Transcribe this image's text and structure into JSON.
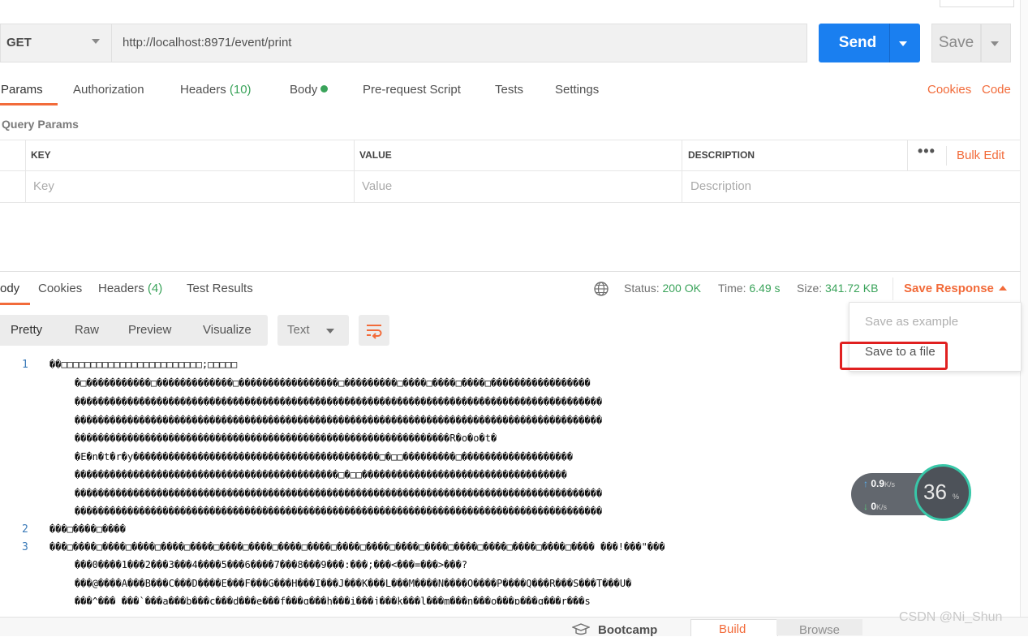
{
  "request": {
    "method": "GET",
    "url": "http://localhost:8971/event/print",
    "send_label": "Send",
    "save_label": "Save"
  },
  "request_tabs": {
    "params": "Params",
    "authorization": "Authorization",
    "headers": "Headers",
    "headers_count": "(10)",
    "body": "Body",
    "prerequest": "Pre-request Script",
    "tests": "Tests",
    "settings": "Settings",
    "cookies": "Cookies",
    "code": "Code"
  },
  "query_params": {
    "title": "Query Params",
    "columns": {
      "key": "KEY",
      "value": "VALUE",
      "description": "DESCRIPTION"
    },
    "placeholders": {
      "key": "Key",
      "value": "Value",
      "description": "Description"
    },
    "more": "•••",
    "bulk_edit": "Bulk Edit"
  },
  "response_tabs": {
    "body": "ody",
    "cookies": "Cookies",
    "headers": "Headers",
    "headers_count": "(4)",
    "test_results": "Test Results"
  },
  "response_meta": {
    "status_label": "Status:",
    "status_value": "200 OK",
    "time_label": "Time:",
    "time_value": "6.49 s",
    "size_label": "Size:",
    "size_value": "341.72 KB",
    "save_response": "Save Response"
  },
  "view_toolbar": {
    "pretty": "Pretty",
    "raw": "Raw",
    "preview": "Preview",
    "visualize": "Visualize",
    "format": "Text"
  },
  "dropdown": {
    "save_as_example": "Save as example",
    "save_to_file": "Save to a file"
  },
  "code": {
    "line_numbers": [
      "1",
      "2",
      "3"
    ],
    "lines": [
      "��□□□□□□□□□□□□□□□□□□□□□□□□;□□□□□",
      "�□�����������□�������������□�����������������□���������□����□����□����□�����������������",
      "������������������������������������������������������������������������������������������",
      "������������������������������������������������������������������������������������������",
      "����������������������������������������������������������������R�o�o�t�",
      "�E�n�t�r�y������������������������������������������□�□□���������□�������������������",
      "���������������������������������������������□�□□�����������������������������������",
      "������������������������������������������������������������������������������������������",
      "������������������������������������������������������������������������������������������",
      "���□����□����",
      "���□����□����□����□����□����□����□����□����□����□����□����□����□����□����□����□����□����□���� ���!���\"���",
      "���0����1���2���3���4����5���6����7���8���9���:���;���<���=���>���?",
      "���@����A���B���C���D����E���F���G���H���I���J���K���L���M����N����O����P����Q���R���S���T���U�",
      "���^��� ���`���a���b���c���d���e���f���g���h���i���j���k���l���m���n���o���p���q���r���s"
    ]
  },
  "speed_widget": {
    "up": "0.9",
    "down": "0",
    "unit": "K/s",
    "percent": "36",
    "percent_sign": "%"
  },
  "bottom_bar": {
    "bootcamp": "Bootcamp",
    "build": "Build",
    "browse": "Browse"
  },
  "watermark": "CSDN @Ni_Shun"
}
